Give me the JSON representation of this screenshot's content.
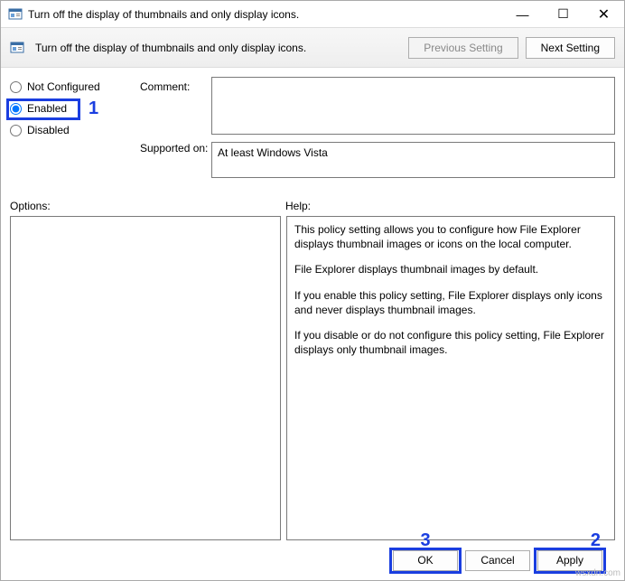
{
  "window": {
    "title": "Turn off the display of thumbnails and only display icons.",
    "controls": {
      "min": "—",
      "max": "☐",
      "close": "✕"
    }
  },
  "toolbar": {
    "label": "Turn off the display of thumbnails and only display icons.",
    "prev": "Previous Setting",
    "next": "Next Setting"
  },
  "radios": {
    "not_configured": "Not Configured",
    "enabled": "Enabled",
    "disabled": "Disabled",
    "selected": "enabled"
  },
  "labels": {
    "comment": "Comment:",
    "supported": "Supported on:",
    "options": "Options:",
    "help": "Help:"
  },
  "supported_text": "At least Windows Vista",
  "help": {
    "p1": "This policy setting allows you to configure how File Explorer displays thumbnail images or icons on the local computer.",
    "p2": "File Explorer displays thumbnail images by default.",
    "p3": "If you enable this policy setting, File Explorer displays only icons and never displays thumbnail images.",
    "p4": "If you disable or do not configure this policy setting, File Explorer displays only thumbnail images."
  },
  "footer": {
    "ok": "OK",
    "cancel": "Cancel",
    "apply": "Apply"
  },
  "callouts": {
    "c1": "1",
    "c2": "2",
    "c3": "3"
  },
  "watermark": "wsxdn.com"
}
